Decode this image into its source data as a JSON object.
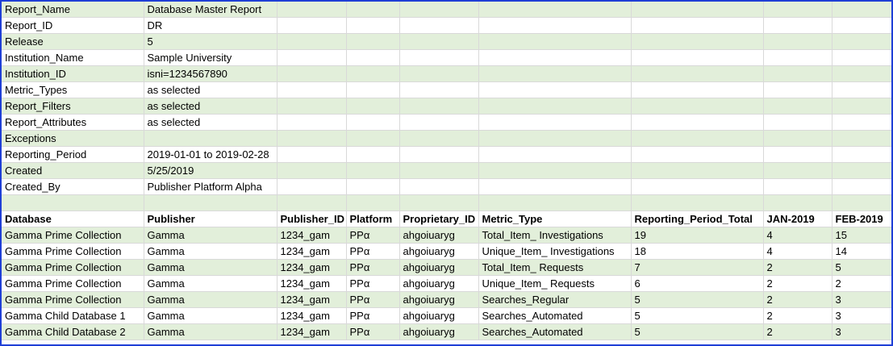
{
  "header_rows": [
    [
      "Report_Name",
      "Database Master Report"
    ],
    [
      "Report_ID",
      "DR"
    ],
    [
      "Release",
      "5"
    ],
    [
      "Institution_Name",
      "Sample University"
    ],
    [
      "Institution_ID",
      "isni=1234567890"
    ],
    [
      "Metric_Types",
      "as selected"
    ],
    [
      "Report_Filters",
      "as selected"
    ],
    [
      "Report_Attributes",
      "as selected"
    ],
    [
      "Exceptions",
      ""
    ],
    [
      "Reporting_Period",
      "2019-01-01 to 2019-02-28"
    ],
    [
      "Created",
      "5/25/2019"
    ],
    [
      "Created_By",
      "Publisher Platform Alpha"
    ]
  ],
  "columns": [
    "Database",
    "Publisher",
    "Publisher_ID",
    "Platform",
    "Proprietary_ID",
    "Metric_Type",
    "Reporting_Period_Total",
    "JAN-2019",
    "FEB-2019"
  ],
  "rows": [
    [
      "Gamma Prime Collection",
      "Gamma",
      "1234_gam",
      "PPα",
      "ahgoiuaryg",
      "Total_Item_ Investigations",
      "19",
      "4",
      "15"
    ],
    [
      "Gamma Prime Collection",
      "Gamma",
      "1234_gam",
      "PPα",
      "ahgoiuaryg",
      "Unique_Item_ Investigations",
      "18",
      "4",
      "14"
    ],
    [
      "Gamma Prime Collection",
      "Gamma",
      "1234_gam",
      "PPα",
      "ahgoiuaryg",
      "Total_Item_ Requests",
      "7",
      "2",
      "5"
    ],
    [
      "Gamma Prime Collection",
      "Gamma",
      "1234_gam",
      "PPα",
      "ahgoiuaryg",
      "Unique_Item_ Requests",
      "6",
      "2",
      "2"
    ],
    [
      "Gamma Prime Collection",
      "Gamma",
      "1234_gam",
      "PPα",
      "ahgoiuaryg",
      "Searches_Regular",
      "5",
      "2",
      "3"
    ],
    [
      "Gamma Child Database 1",
      "Gamma",
      "1234_gam",
      "PPα",
      "ahgoiuaryg",
      "Searches_Automated",
      "5",
      "2",
      "3"
    ],
    [
      "Gamma Child Database 2",
      "Gamma",
      "1234_gam",
      "PPα",
      "ahgoiuaryg",
      "Searches_Automated",
      "5",
      "2",
      "3"
    ]
  ]
}
